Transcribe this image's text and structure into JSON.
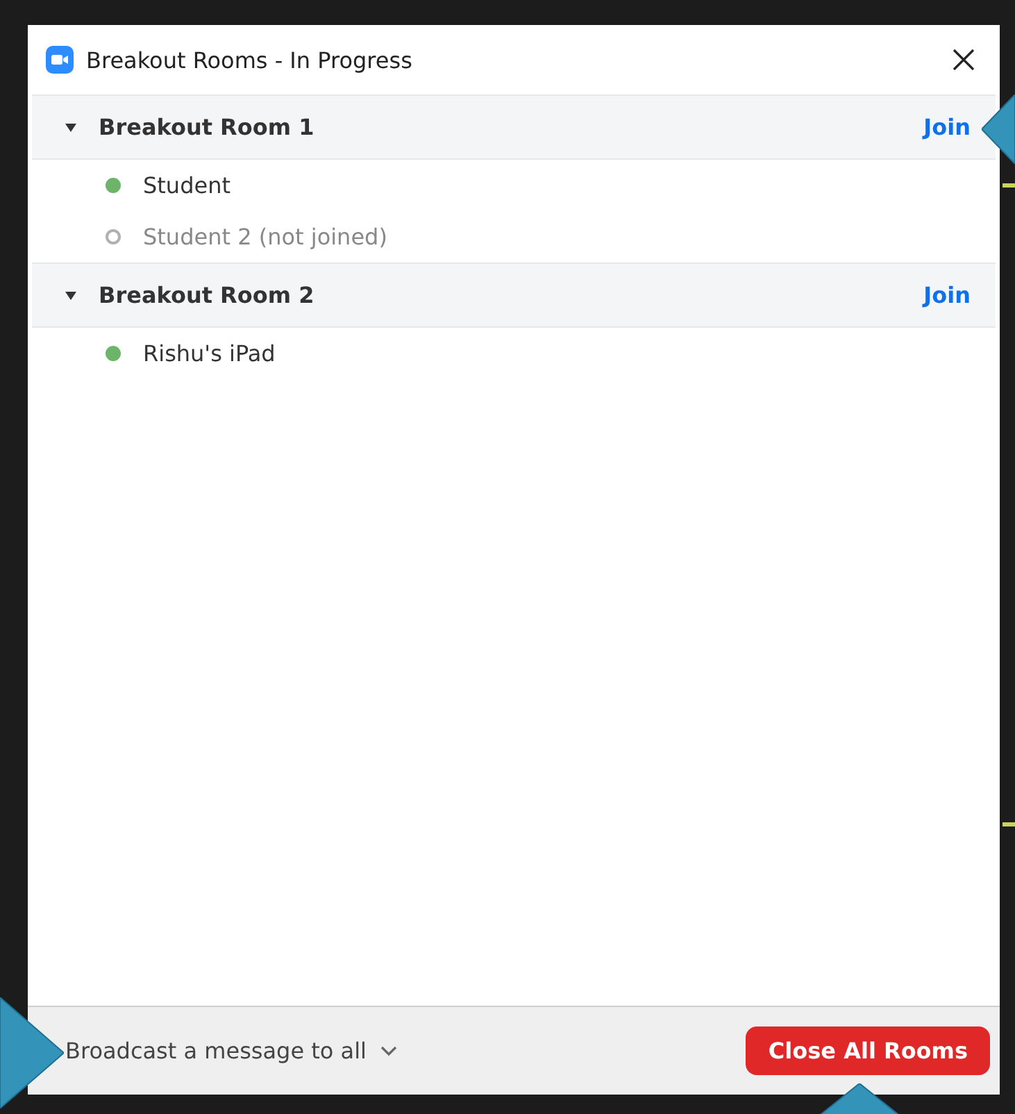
{
  "window": {
    "title": "Breakout Rooms - In Progress"
  },
  "rooms": [
    {
      "name": "Breakout Room 1",
      "expanded": true,
      "action": "Join",
      "participants": [
        {
          "name": "Student",
          "joined": true
        },
        {
          "name": "Student 2 (not joined)",
          "joined": false
        }
      ]
    },
    {
      "name": "Breakout Room 2",
      "expanded": true,
      "action": "Join",
      "participants": [
        {
          "name": "Rishu's iPad",
          "joined": true
        }
      ]
    }
  ],
  "footer": {
    "broadcast": "Broadcast a message to all",
    "close_button": "Close All Rooms"
  }
}
